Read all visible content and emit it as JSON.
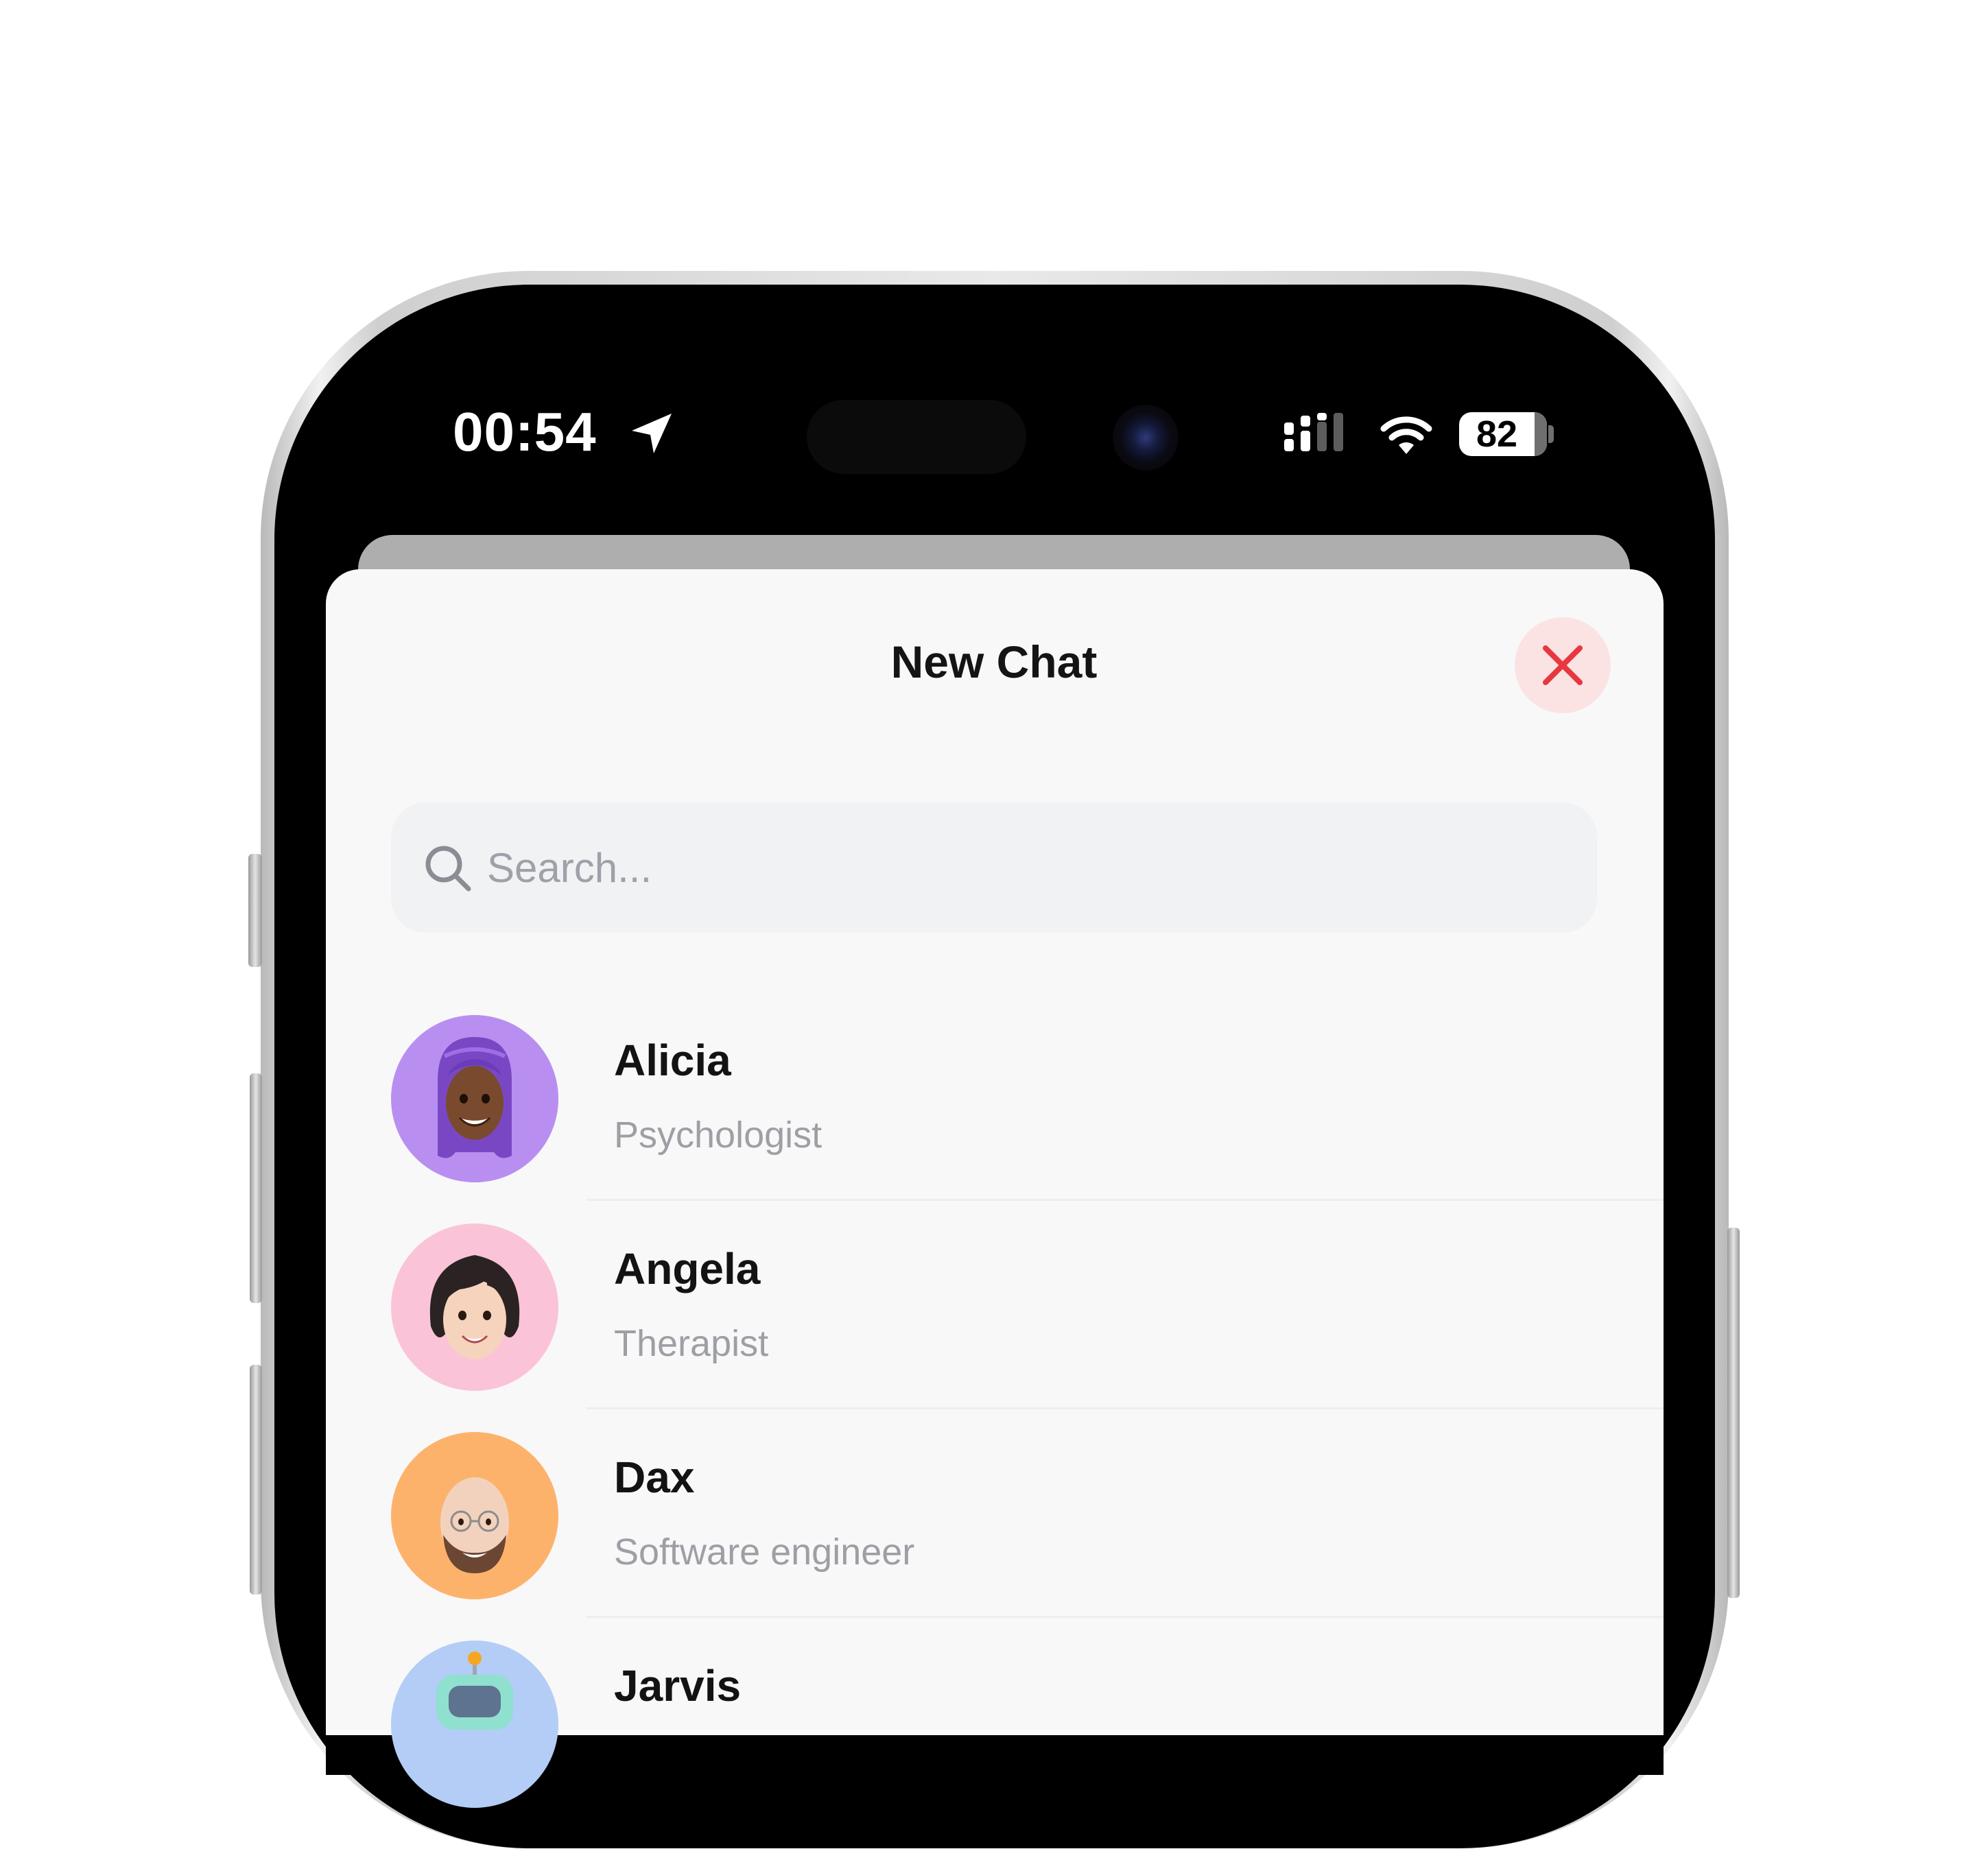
{
  "status_bar": {
    "time": "00:54",
    "battery_level": "82"
  },
  "sheet": {
    "title": "New Chat"
  },
  "search": {
    "placeholder": "Search..."
  },
  "contacts": [
    {
      "name": "Alicia",
      "role": "Psychologist",
      "avatar_color": "#b88ff0"
    },
    {
      "name": "Angela",
      "role": "Therapist",
      "avatar_color": "#fbc3d8"
    },
    {
      "name": "Dax",
      "role": "Software engineer",
      "avatar_color": "#fdb26c"
    },
    {
      "name": "Jarvis",
      "role": "",
      "avatar_color": "#b3cdf6"
    }
  ],
  "colors": {
    "close_accent": "#e8373e",
    "close_background": "#fbe3e4",
    "sheet_background": "#f8f8f8",
    "search_background": "#f1f2f4"
  },
  "icons": {
    "close": "close-icon",
    "search": "search-icon",
    "location": "location-arrow-icon",
    "signal": "cellular-signal-icon",
    "wifi": "wifi-icon",
    "battery": "battery-icon"
  }
}
